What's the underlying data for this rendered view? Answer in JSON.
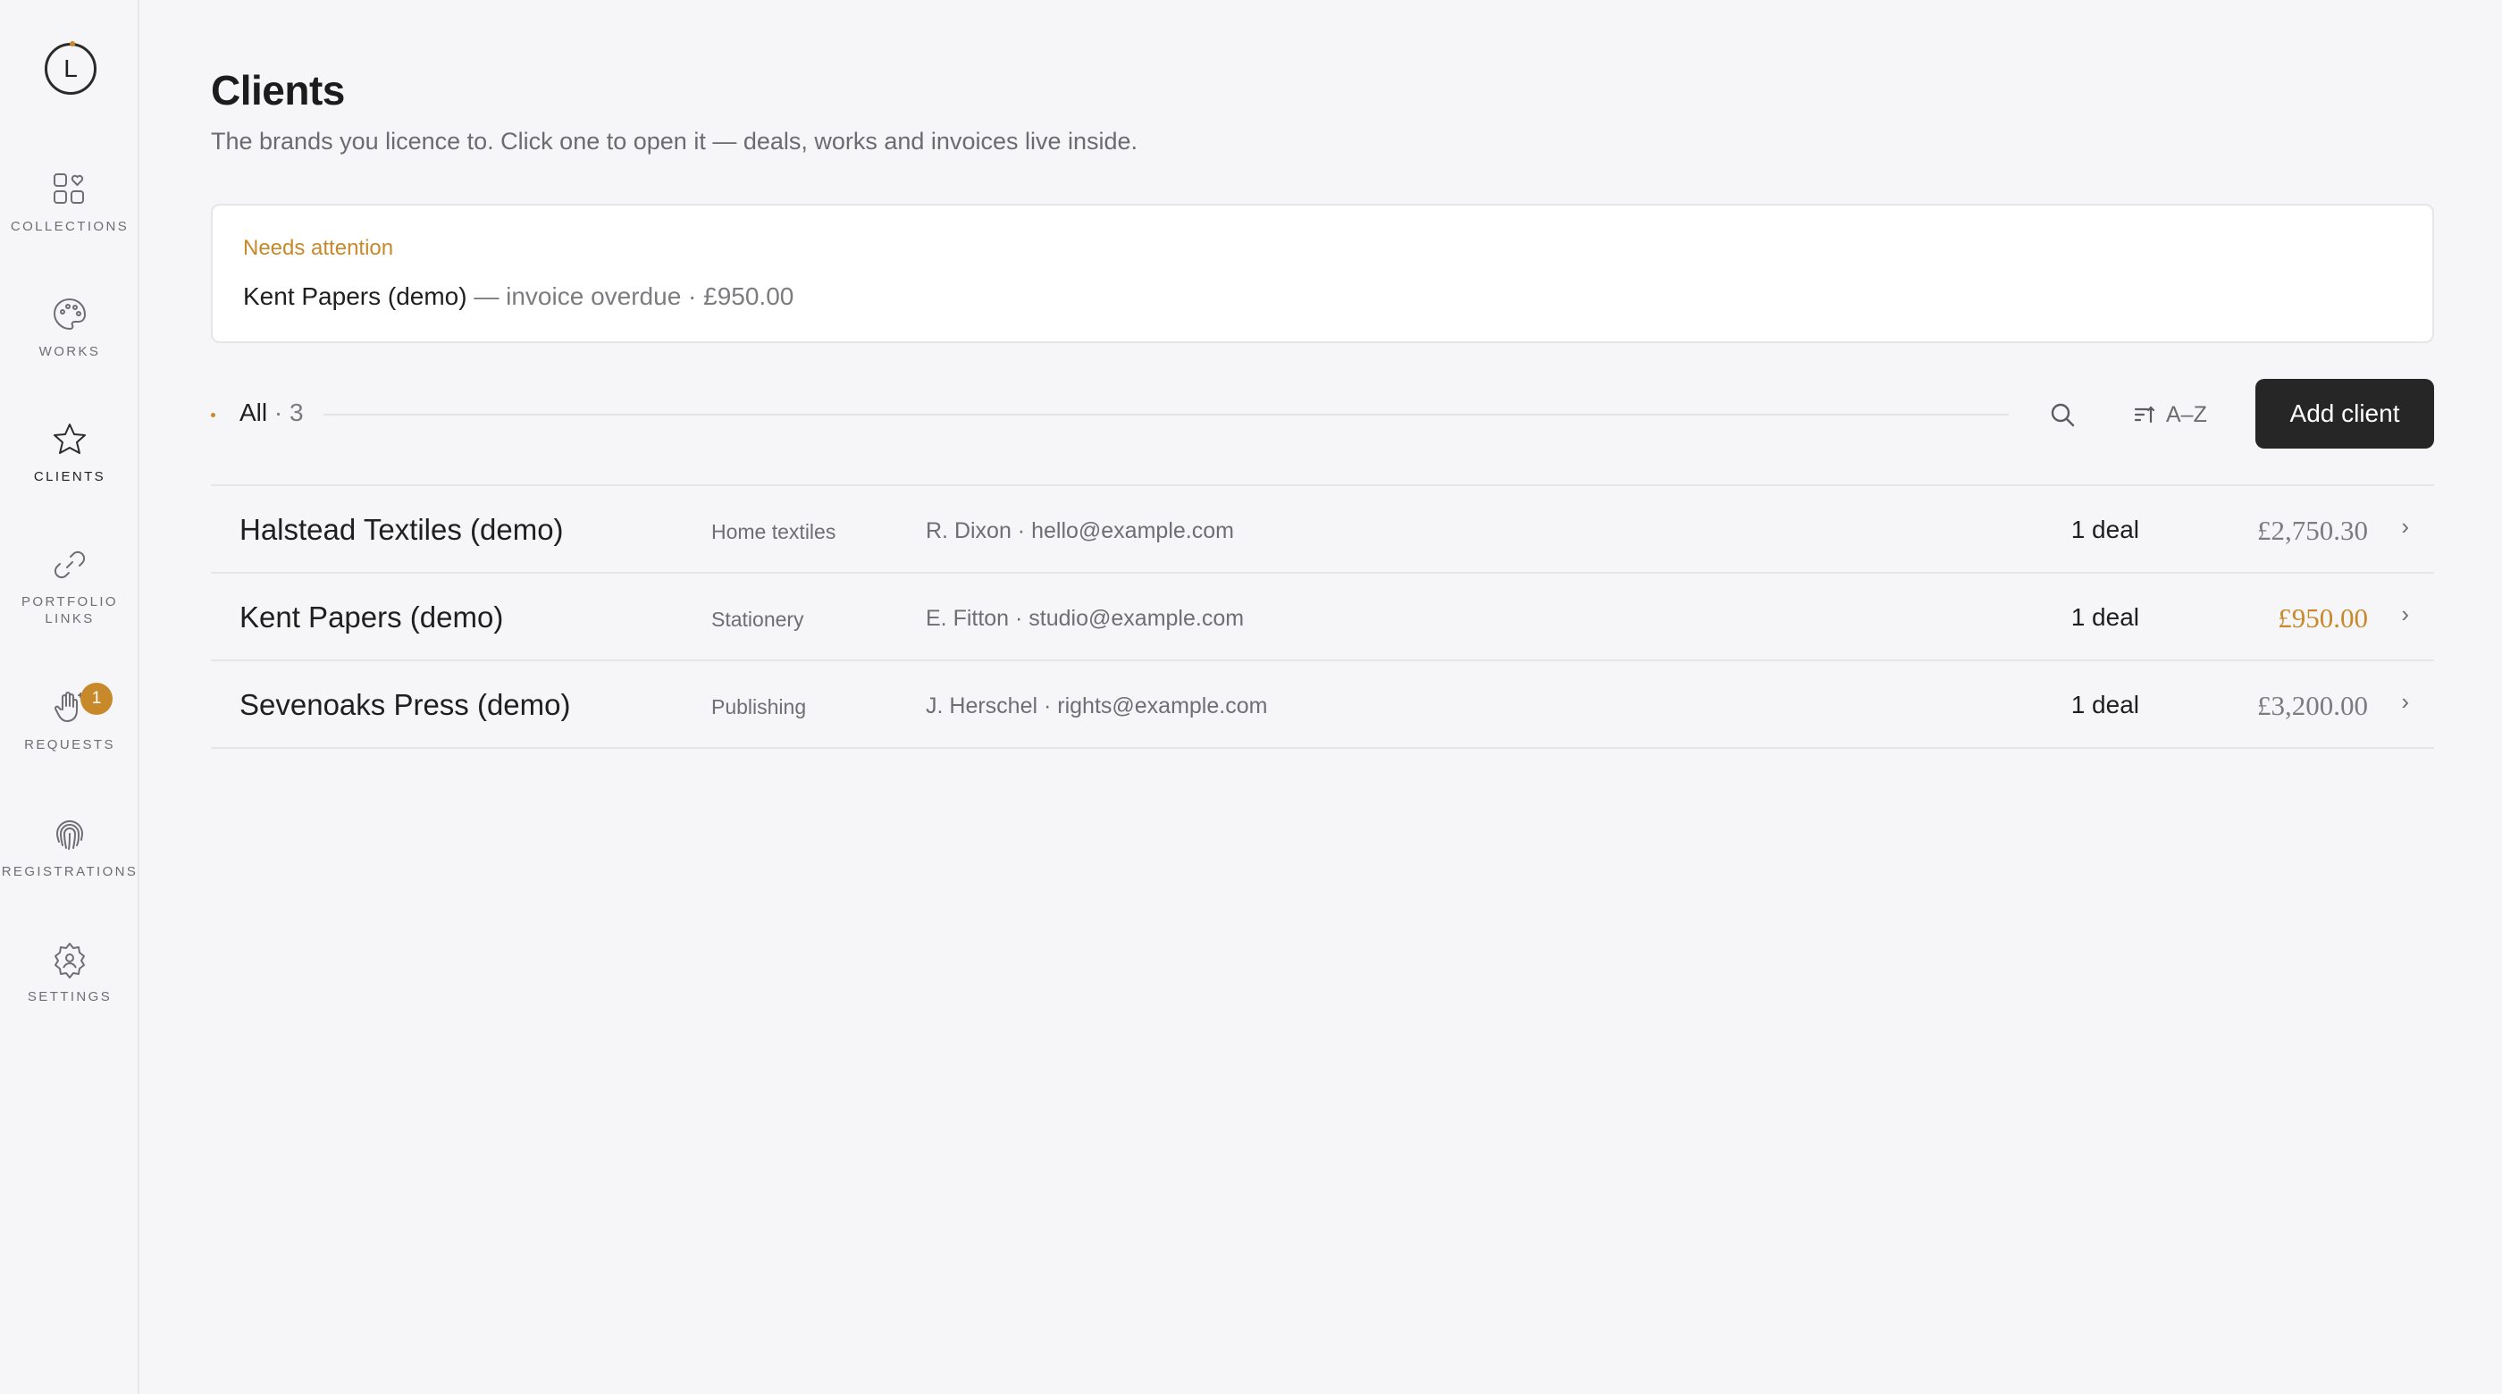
{
  "app": {
    "logo_letter": "L"
  },
  "sidebar": {
    "items": [
      {
        "label": "COLLECTIONS",
        "icon": "collections-icon"
      },
      {
        "label": "WORKS",
        "icon": "palette-icon"
      },
      {
        "label": "CLIENTS",
        "icon": "star-icon",
        "active": true
      },
      {
        "label": "PORTFOLIO\nLINKS",
        "icon": "link-icon"
      },
      {
        "label": "REQUESTS",
        "icon": "hand-icon",
        "badge": "1"
      },
      {
        "label": "REGISTRATIONS",
        "icon": "fingerprint-icon"
      },
      {
        "label": "SETTINGS",
        "icon": "gear-icon"
      }
    ]
  },
  "page": {
    "title": "Clients",
    "subtitle": "The brands you licence to. Click one to open it — deals, works and invoices live inside."
  },
  "attention": {
    "title": "Needs attention",
    "client": "Kent Papers (demo)",
    "detail": " — invoice overdue · £950.00"
  },
  "toolbar": {
    "filter_label": "All",
    "filter_count": " · 3",
    "sort_label": "A–Z",
    "add_label": "Add client"
  },
  "clients": [
    {
      "name": "Halstead Textiles (demo)",
      "industry": "Home textiles",
      "contact": "R. Dixon · hello@example.com",
      "deals": "1 deal",
      "amount": "£2,750.30",
      "overdue": false
    },
    {
      "name": "Kent Papers (demo)",
      "industry": "Stationery",
      "contact": "E. Fitton · studio@example.com",
      "deals": "1 deal",
      "amount": "£950.00",
      "overdue": true
    },
    {
      "name": "Sevenoaks Press (demo)",
      "industry": "Publishing",
      "contact": "J. Herschel · rights@example.com",
      "deals": "1 deal",
      "amount": "£3,200.00",
      "overdue": false
    }
  ],
  "colors": {
    "accent": "#c8892a",
    "button": "#262626",
    "background": "#f6f6f8"
  }
}
